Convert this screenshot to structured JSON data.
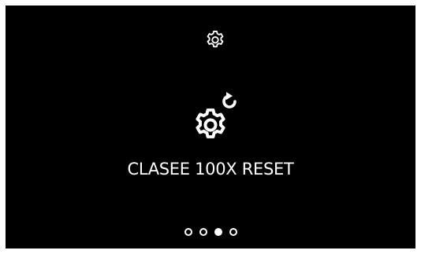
{
  "colors": {
    "background": "#000000",
    "frame": "#ffffff",
    "foreground": "#ffffff"
  },
  "header": {
    "icon": "settings-gear-icon"
  },
  "main": {
    "icon": "gear-reset-icon",
    "title": "CLASEE 100X RESET"
  },
  "pagination": {
    "total": 4,
    "active_index": 2
  }
}
